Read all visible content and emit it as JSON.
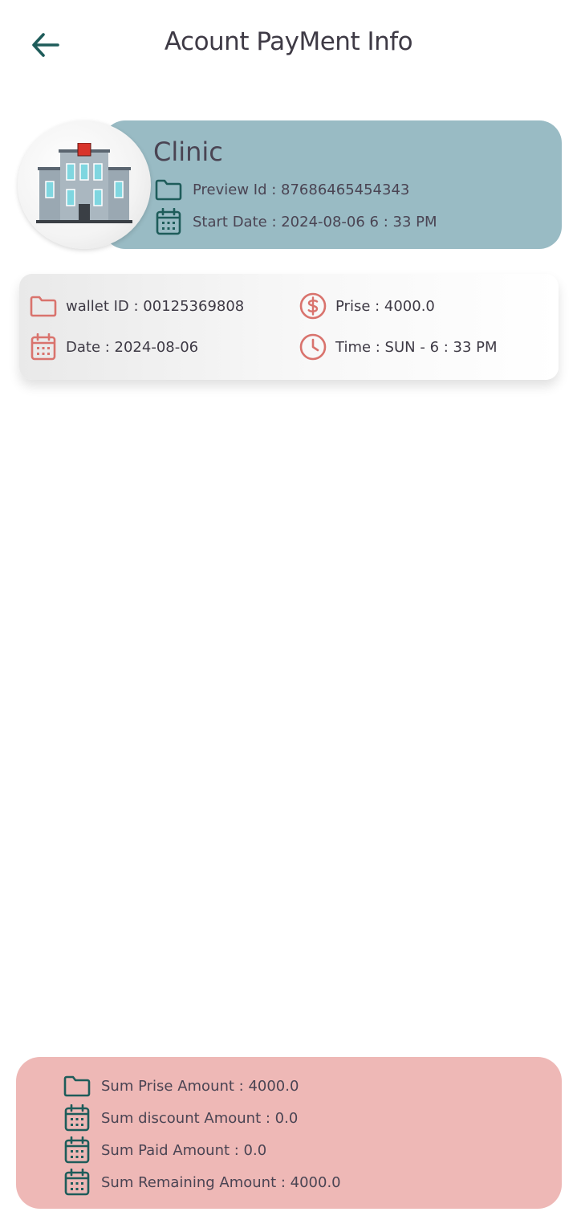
{
  "header": {
    "title": "Acount PayMent Info"
  },
  "clinic": {
    "name": "Clinic",
    "preview_id": "Preview Id : 87686465454343",
    "start_date": "Start Date : 2024-08-06  6 : 33 PM"
  },
  "wallet": {
    "wallet_id": "wallet ID : 00125369808",
    "prise": "Prise : 4000.0",
    "date": "Date : 2024-08-06",
    "time": "Time : SUN - 6 : 33 PM"
  },
  "summary": {
    "sum_prise": "Sum  Prise Amount : 4000.0",
    "sum_discount": "Sum discount Amount : 0.0",
    "sum_paid": "Sum Paid Amount : 0.0",
    "sum_remaining": "Sum Remaining Amount : 4000.0"
  },
  "colors": {
    "teal_icon": "#1e5c5a",
    "salmon_icon": "#d9736d",
    "clinic_card": "#99bbc4",
    "summary_card": "#eeb8b6"
  },
  "icons": {
    "back": "arrow-left-icon",
    "folder": "folder-icon",
    "calendar": "calendar-icon",
    "dollar": "dollar-circle-icon",
    "clock": "clock-icon",
    "building": "hospital-building-icon"
  }
}
